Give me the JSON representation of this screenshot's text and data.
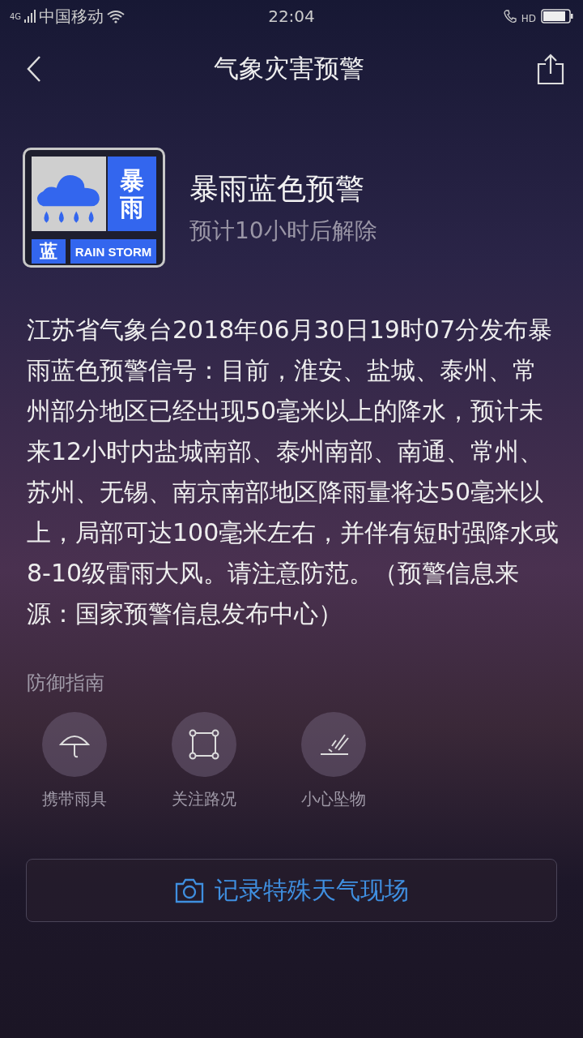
{
  "status_bar": {
    "network": "4G",
    "carrier": "中国移动",
    "time": "22:04",
    "call_badge": "HD"
  },
  "header": {
    "title": "气象灾害预警"
  },
  "warning": {
    "badge": {
      "top_label": "暴",
      "bottom_label": "雨",
      "level_label": "蓝",
      "english": "RAIN STORM",
      "color": "#3366ee"
    },
    "title": "暴雨蓝色预警",
    "subtitle": "预计10小时后解除",
    "body": "江苏省气象台2018年06月30日19时07分发布暴雨蓝色预警信号：目前，淮安、盐城、泰州、常州部分地区已经出现50毫米以上的降水，预计未来12小时内盐城南部、泰州南部、南通、常州、苏州、无锡、南京南部地区降雨量将达50毫米以上，局部可达100毫米左右，并伴有短时强降水或8-10级雷雨大风。请注意防范。（预警信息来源：国家预警信息发布中心）"
  },
  "guide": {
    "heading": "防御指南",
    "items": [
      {
        "kind": "umbrella",
        "label": "携带雨具"
      },
      {
        "kind": "road",
        "label": "关注路况"
      },
      {
        "kind": "falling",
        "label": "小心坠物"
      }
    ]
  },
  "record_button": {
    "label": "记录特殊天气现场"
  }
}
